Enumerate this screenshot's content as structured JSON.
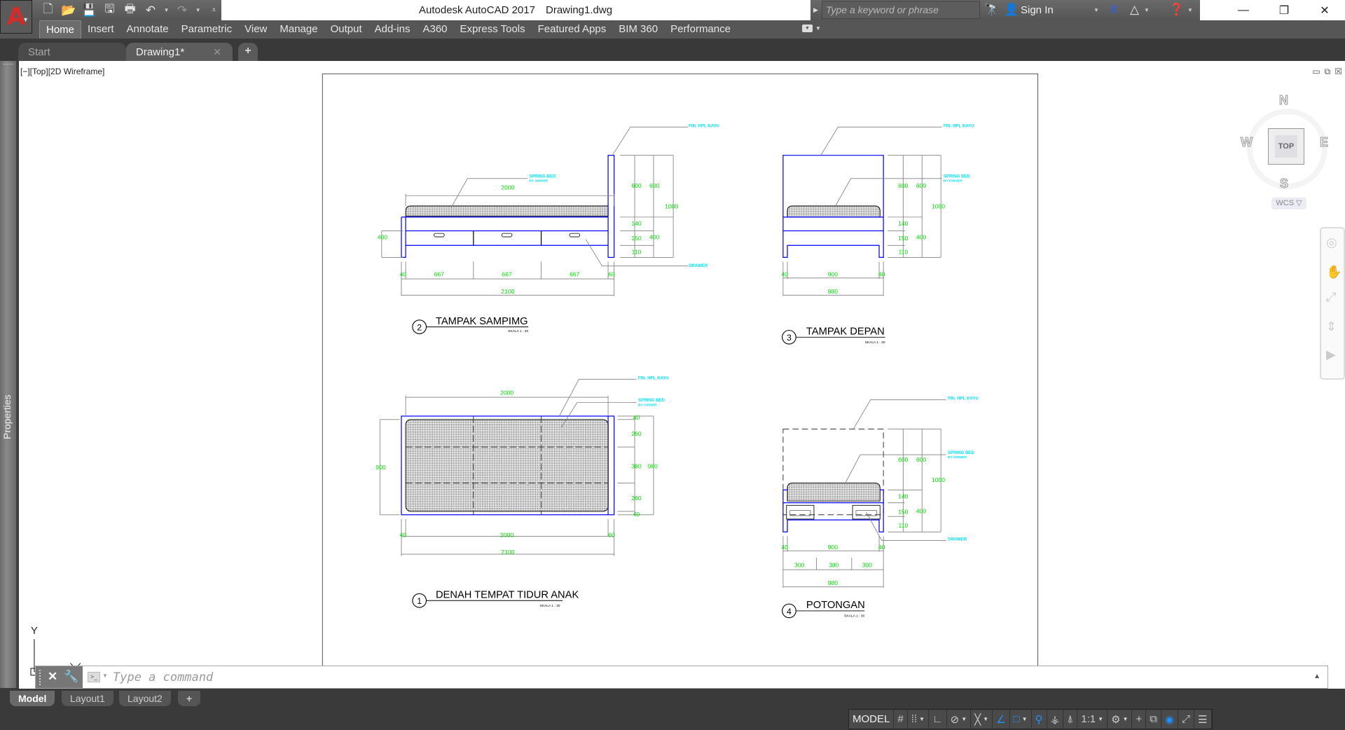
{
  "window": {
    "app_title": "Autodesk AutoCAD 2017",
    "file_name": "Drawing1.dwg",
    "minimize": "—",
    "restore": "❐",
    "close": "✕"
  },
  "quick_access": {
    "icons": [
      "new-icon",
      "open-icon",
      "save-icon",
      "save-as-icon",
      "plot-icon",
      "undo-icon",
      "redo-icon",
      "customize-icon"
    ]
  },
  "search": {
    "placeholder": "Type a keyword or phrase",
    "sign_in": "Sign In"
  },
  "ribbon": {
    "tabs": [
      "Home",
      "Insert",
      "Annotate",
      "Parametric",
      "View",
      "Manage",
      "Output",
      "Add-ins",
      "A360",
      "Express Tools",
      "Featured Apps",
      "BIM 360",
      "Performance"
    ],
    "active": "Home"
  },
  "file_tabs": {
    "start": "Start",
    "drawing": "Drawing1*",
    "close": "✕",
    "add": "+"
  },
  "palette": {
    "properties": "Properties"
  },
  "viewport": {
    "label": "[−][Top][2D Wireframe]",
    "ctrl_min": "▭",
    "ctrl_restore": "⧉",
    "ctrl_close": "☒"
  },
  "viewcube": {
    "n": "N",
    "s": "S",
    "e": "E",
    "w": "W",
    "face": "TOP",
    "wcs": "WCS ▽"
  },
  "ucs": {
    "y": "Y",
    "x": "X"
  },
  "drawing": {
    "colors": {
      "frame": "#0000ff",
      "dim": "#00cc00",
      "leader": "#808080",
      "note": "#00e5ff",
      "line": "#000000"
    },
    "notes": {
      "finish": "FIN. HPL KAYU",
      "spring_bed": "SPRING BED",
      "by_owner": "BY OWNER",
      "drawer": "DRAWER"
    },
    "views": [
      {
        "number": "2",
        "title": "TAMPAK SAMPIMG",
        "scale": "SKALA 1 : 30",
        "dims": {
          "top": "2000",
          "left": "400",
          "seg1": "667",
          "seg2": "667",
          "seg3": "667",
          "left_end": "40",
          "right_end": "60",
          "total": "2100",
          "r600a": "600",
          "r600b": "600",
          "r1000": "1000",
          "r140": "140",
          "r150": "150",
          "r110": "110",
          "r400": "400"
        }
      },
      {
        "number": "3",
        "title": "TAMPAK DEPAN",
        "scale": "SKALA 1 : 30",
        "dims": {
          "left_end": "40",
          "inner": "900",
          "right_end": "40",
          "total": "980",
          "r600a": "600",
          "r600b": "600",
          "r1000": "1000",
          "r140": "140",
          "r150": "150",
          "r110": "110",
          "r400": "400"
        }
      },
      {
        "number": "1",
        "title": "DENAH TEMPAT TIDUR ANAK",
        "scale": "SKALA 1 : 30",
        "dims": {
          "top": "2000",
          "left": "900",
          "left_end": "40",
          "inner": "2000",
          "right_end": "60",
          "total": "2100",
          "r40a": "40",
          "r260a": "260",
          "r380": "380",
          "r260b": "260",
          "r40b": "40",
          "r980": "980"
        }
      },
      {
        "number": "4",
        "title": "POTONGAN",
        "scale": "SKALA 1 : 30",
        "dims": {
          "left_end": "40",
          "inner": "900",
          "right_end": "40",
          "s300a": "300",
          "s380": "380",
          "s300b": "300",
          "total": "980",
          "r600a": "600",
          "r600b": "600",
          "r1000": "1000",
          "r140": "140",
          "r150": "150",
          "r110": "110",
          "r400": "400"
        }
      }
    ]
  },
  "command_line": {
    "placeholder": "Type a command",
    "close": "✕",
    "customize": "🔧",
    "history": "▲"
  },
  "layout_tabs": {
    "model": "Model",
    "layout1": "Layout1",
    "layout2": "Layout2",
    "add": "+"
  },
  "status_bar": {
    "model": "MODEL",
    "scale": "1:1",
    "icons": [
      "grid-icon",
      "snap-icon",
      "ortho-icon",
      "polar-icon",
      "isodraft-icon",
      "osnap-tracking-icon",
      "osnap-icon",
      "annotation-visibility-icon",
      "auto-scale-icon",
      "annotation-scale-icon",
      "workspace-icon",
      "units-icon",
      "quick-properties-icon",
      "isolate-icon",
      "hardware-acceleration-icon",
      "fullscreen-icon",
      "customization-icon"
    ]
  }
}
